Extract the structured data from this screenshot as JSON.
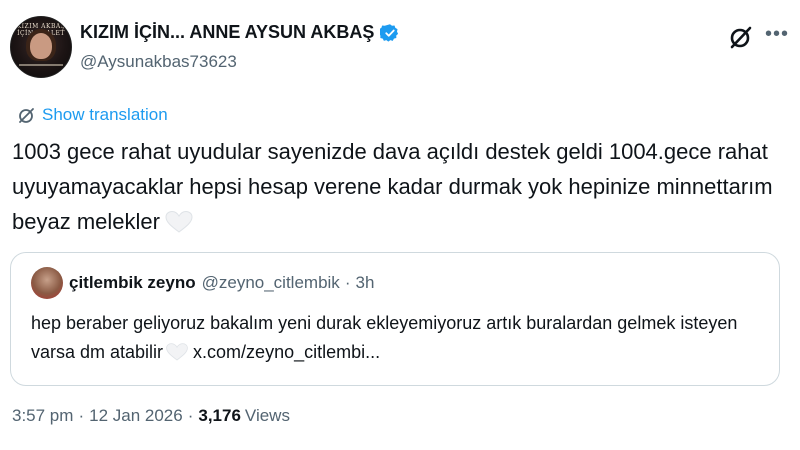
{
  "author": {
    "display_name": "KIZIM İÇİN... ANNE AYSUN AKBAŞ",
    "handle": "@Aysunakbas73623",
    "avatar_text": "KIZIM AKBAŞ İÇİN ADALET"
  },
  "icons": {
    "verified": "verified-badge-icon",
    "grok": "grok-icon",
    "more": "more-icon",
    "translate": "translate-icon",
    "heart": "white-heart-icon"
  },
  "colors": {
    "link_blue": "#1d9bf0",
    "secondary_text": "#536471",
    "primary_text": "#0f1419",
    "border": "#cfd9de"
  },
  "translate_label": "Show translation",
  "tweet": {
    "text": "1003 gece rahat uyudular sayenizde dava açıldı destek geldi 1004.gece rahat uyuyamayacaklar hepsi hesap verene kadar durmak yok hepinize minnettarım beyaz melekler"
  },
  "quote": {
    "display_name": "çitlembik zeyno",
    "handle": "@zeyno_citlembik",
    "dot": "·",
    "time": "3h",
    "text_before": "hep beraber geliyoruz bakalım yeni durak ekleyemiyoruz artık buralardan gelmek isteyen varsa dm atabilir",
    "link": "x.com/zeyno_citlembi..."
  },
  "meta": {
    "time": "3:57 pm",
    "sep": "·",
    "date": "12 Jan 2026",
    "views_count": "3,176",
    "views_label": "Views"
  }
}
